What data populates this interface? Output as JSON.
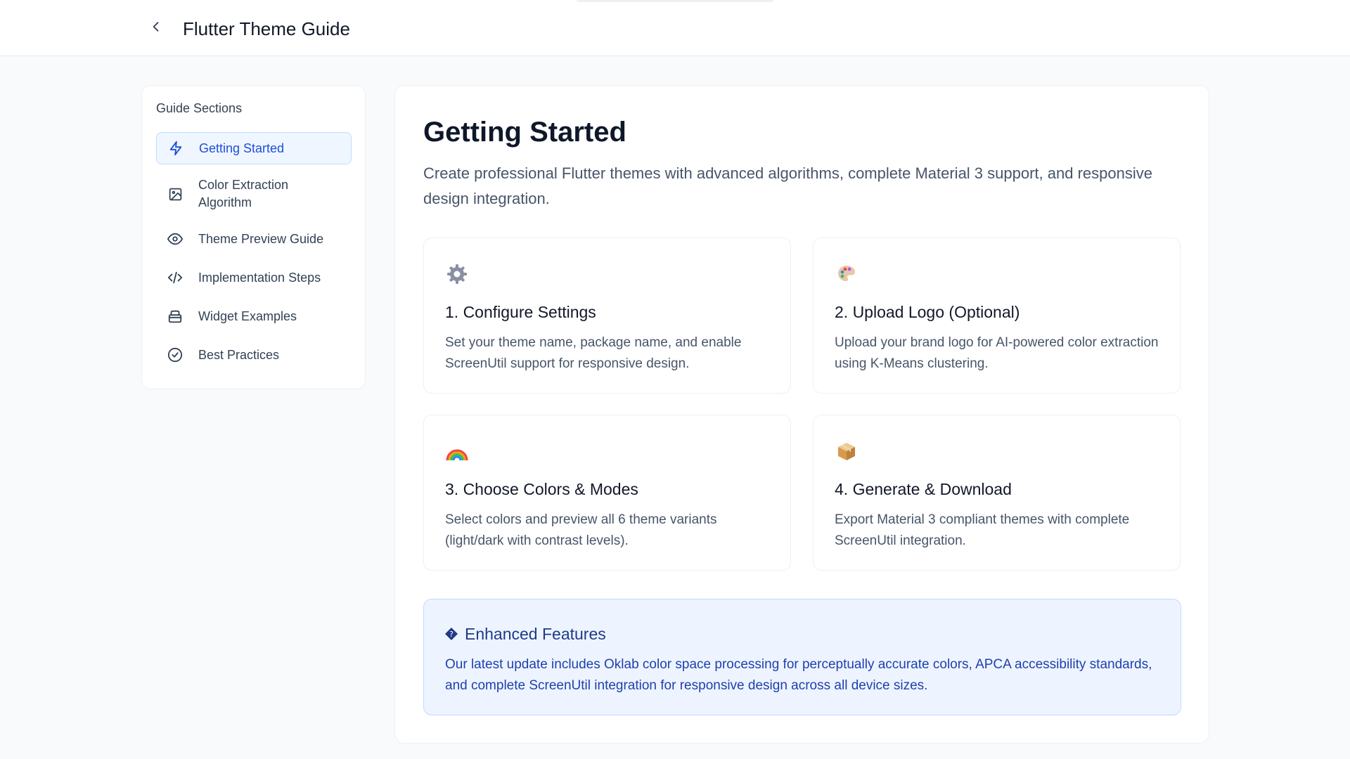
{
  "header": {
    "title": "Flutter Theme Guide",
    "back_icon": "chevron-left-icon"
  },
  "sidebar": {
    "heading": "Guide Sections",
    "items": [
      {
        "label": "Getting Started",
        "icon": "lightning-icon",
        "active": true
      },
      {
        "label": "Color Extraction Algorithm",
        "icon": "image-icon",
        "active": false
      },
      {
        "label": "Theme Preview Guide",
        "icon": "eye-icon",
        "active": false
      },
      {
        "label": "Implementation Steps",
        "icon": "code-icon",
        "active": false
      },
      {
        "label": "Widget Examples",
        "icon": "box-icon",
        "active": false
      },
      {
        "label": "Best Practices",
        "icon": "check-circle-icon",
        "active": false
      }
    ]
  },
  "main": {
    "title": "Getting Started",
    "description": "Create professional Flutter themes with advanced algorithms, complete Material 3 support, and responsive design integration.",
    "cards": [
      {
        "icon": "gear-icon",
        "title": "1. Configure Settings",
        "text": "Set your theme name, package name, and enable ScreenUtil support for responsive design."
      },
      {
        "icon": "palette-icon",
        "title": "2. Upload Logo (Optional)",
        "text": "Upload your brand logo for AI-powered color extraction using K-Means clustering."
      },
      {
        "icon": "rainbow-icon",
        "title": "3. Choose Colors & Modes",
        "text": "Select colors and preview all 6 theme variants (light/dark with contrast levels)."
      },
      {
        "icon": "package-icon",
        "title": "4. Generate & Download",
        "text": "Export Material 3 compliant themes with complete ScreenUtil integration."
      }
    ],
    "info": {
      "icon": "diamond-icon",
      "title": "Enhanced Features",
      "text": "Our latest update includes Oklab color space processing for perceptually accurate colors, APCA accessibility standards, and complete ScreenUtil integration for responsive design across all device sizes."
    }
  },
  "colors": {
    "accent": "#1d4ed8",
    "active_bg": "#eff6ff",
    "info_bg": "#eef4ff",
    "info_text": "#1e40af"
  }
}
